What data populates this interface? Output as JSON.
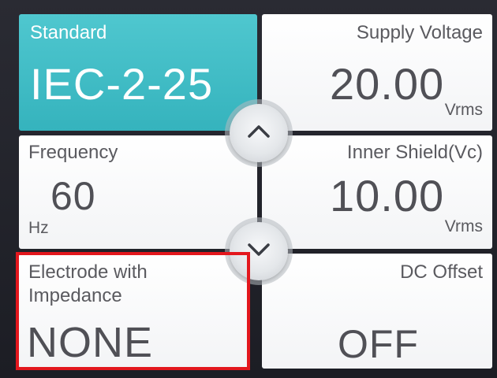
{
  "tiles": {
    "standard": {
      "label": "Standard",
      "value": "IEC-2-25"
    },
    "supply_voltage": {
      "label": "Supply Voltage",
      "value": "20.00",
      "unit": "Vrms"
    },
    "frequency": {
      "label": "Frequency",
      "value": "60",
      "unit": "Hz"
    },
    "inner_shield": {
      "label": "Inner Shield(Vc)",
      "value": "10.00",
      "unit": "Vrms"
    },
    "electrode": {
      "label_line1": "Electrode with",
      "label_line2": "Impedance",
      "value": "NONE"
    },
    "dc_offset": {
      "label": "DC Offset",
      "value": "OFF"
    }
  },
  "nav": {
    "up_icon": "chevron-up-icon",
    "down_icon": "chevron-down-icon"
  },
  "colors": {
    "accent": "#3fbcc5",
    "highlight": "#e3171d",
    "text": "#505056"
  }
}
